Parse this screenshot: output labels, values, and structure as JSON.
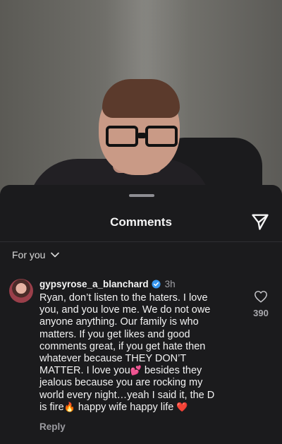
{
  "sheet": {
    "title": "Comments",
    "send_icon": "paper-plane-icon",
    "filter_label": "For you",
    "filter_icon": "chevron-down-icon"
  },
  "comment": {
    "username": "gypsyrose_a_blanchard",
    "verified_icon": "verified-badge-icon",
    "time": "3h",
    "text_part1": "Ryan, don’t listen to the haters. I love you, and you love me. We do not owe anyone anything. Our family is who matters. If you get likes and good comments great, if you get hate then whatever because THEY DON’T MATTER. I love you",
    "emoji_hearts": "💕",
    "text_part2": " besides they jealous because you are rocking my world every night…yeah I said it, the D is fire",
    "emoji_fire": "🔥",
    "text_part3": " happy wife happy life ",
    "emoji_heart": "❤️",
    "like_icon": "heart-outline-icon",
    "like_count": "390",
    "reply_label": "Reply"
  },
  "colors": {
    "sheet_bg": "#1b1b1d",
    "text_primary": "#f5f5f5",
    "text_secondary": "#a0a0a5",
    "verified_blue": "#3897f0"
  }
}
